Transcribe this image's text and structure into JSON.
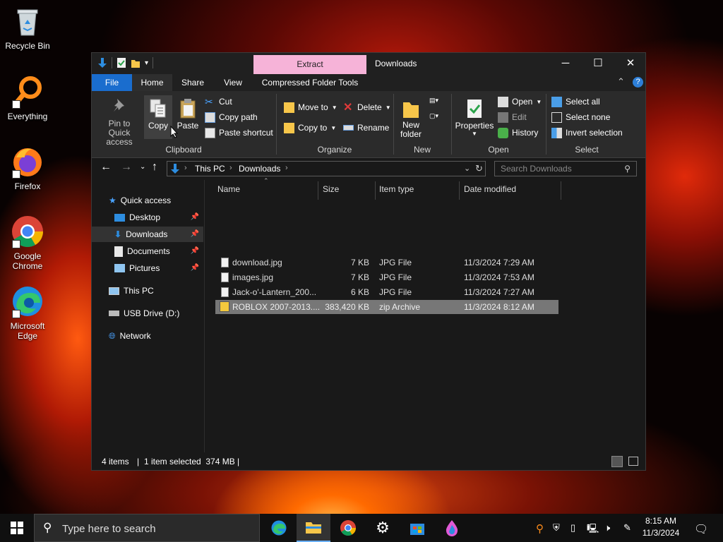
{
  "desktop": {
    "icons": [
      {
        "label": "Recycle Bin"
      },
      {
        "label": "Everything"
      },
      {
        "label": "Firefox"
      },
      {
        "label": "Google Chrome"
      },
      {
        "label": "Microsoft Edge"
      }
    ]
  },
  "window": {
    "title": "Downloads",
    "context_tab": "Extract",
    "tabs": [
      "File",
      "Home",
      "Share",
      "View",
      "Compressed Folder Tools"
    ],
    "ribbon": {
      "clipboard": {
        "label": "Clipboard",
        "pin": "Pin to Quick access",
        "copy": "Copy",
        "paste": "Paste",
        "cut": "Cut",
        "copy_path": "Copy path",
        "paste_shortcut": "Paste shortcut"
      },
      "organize": {
        "label": "Organize",
        "move_to": "Move to",
        "copy_to": "Copy to",
        "delete": "Delete",
        "rename": "Rename"
      },
      "new": {
        "label": "New",
        "new_folder": "New folder"
      },
      "open": {
        "label": "Open",
        "properties": "Properties",
        "open": "Open",
        "edit": "Edit",
        "history": "History"
      },
      "select": {
        "label": "Select",
        "select_all": "Select all",
        "select_none": "Select none",
        "invert": "Invert selection"
      }
    },
    "address": {
      "crumbs": [
        "This PC",
        "Downloads"
      ],
      "search_placeholder": "Search Downloads"
    },
    "nav": {
      "quick_access": "Quick access",
      "desktop": "Desktop",
      "downloads": "Downloads",
      "documents": "Documents",
      "pictures": "Pictures",
      "this_pc": "This PC",
      "usb": "USB Drive (D:)",
      "network": "Network"
    },
    "columns": {
      "name": "Name",
      "size": "Size",
      "type": "Item type",
      "date": "Date modified"
    },
    "files": [
      {
        "name": "download.jpg",
        "size": "7 KB",
        "type": "JPG File",
        "date": "11/3/2024 7:29 AM"
      },
      {
        "name": "images.jpg",
        "size": "7 KB",
        "type": "JPG File",
        "date": "11/3/2024 7:53 AM"
      },
      {
        "name": "Jack-o'-Lantern_200...",
        "size": "6 KB",
        "type": "JPG File",
        "date": "11/3/2024 7:27 AM"
      },
      {
        "name": "ROBLOX 2007-2013....",
        "size": "383,420 KB",
        "type": "zip Archive",
        "date": "11/3/2024 8:12 AM"
      }
    ],
    "status": {
      "items": "4 items",
      "selected": "1 item selected  374 MB"
    }
  },
  "taskbar": {
    "search_placeholder": "Type here to search",
    "time": "8:15 AM",
    "date": "11/3/2024"
  },
  "colors": {
    "accent": "#1a6dce",
    "context_tab": "#f6b3d8",
    "selection": "#777777"
  }
}
